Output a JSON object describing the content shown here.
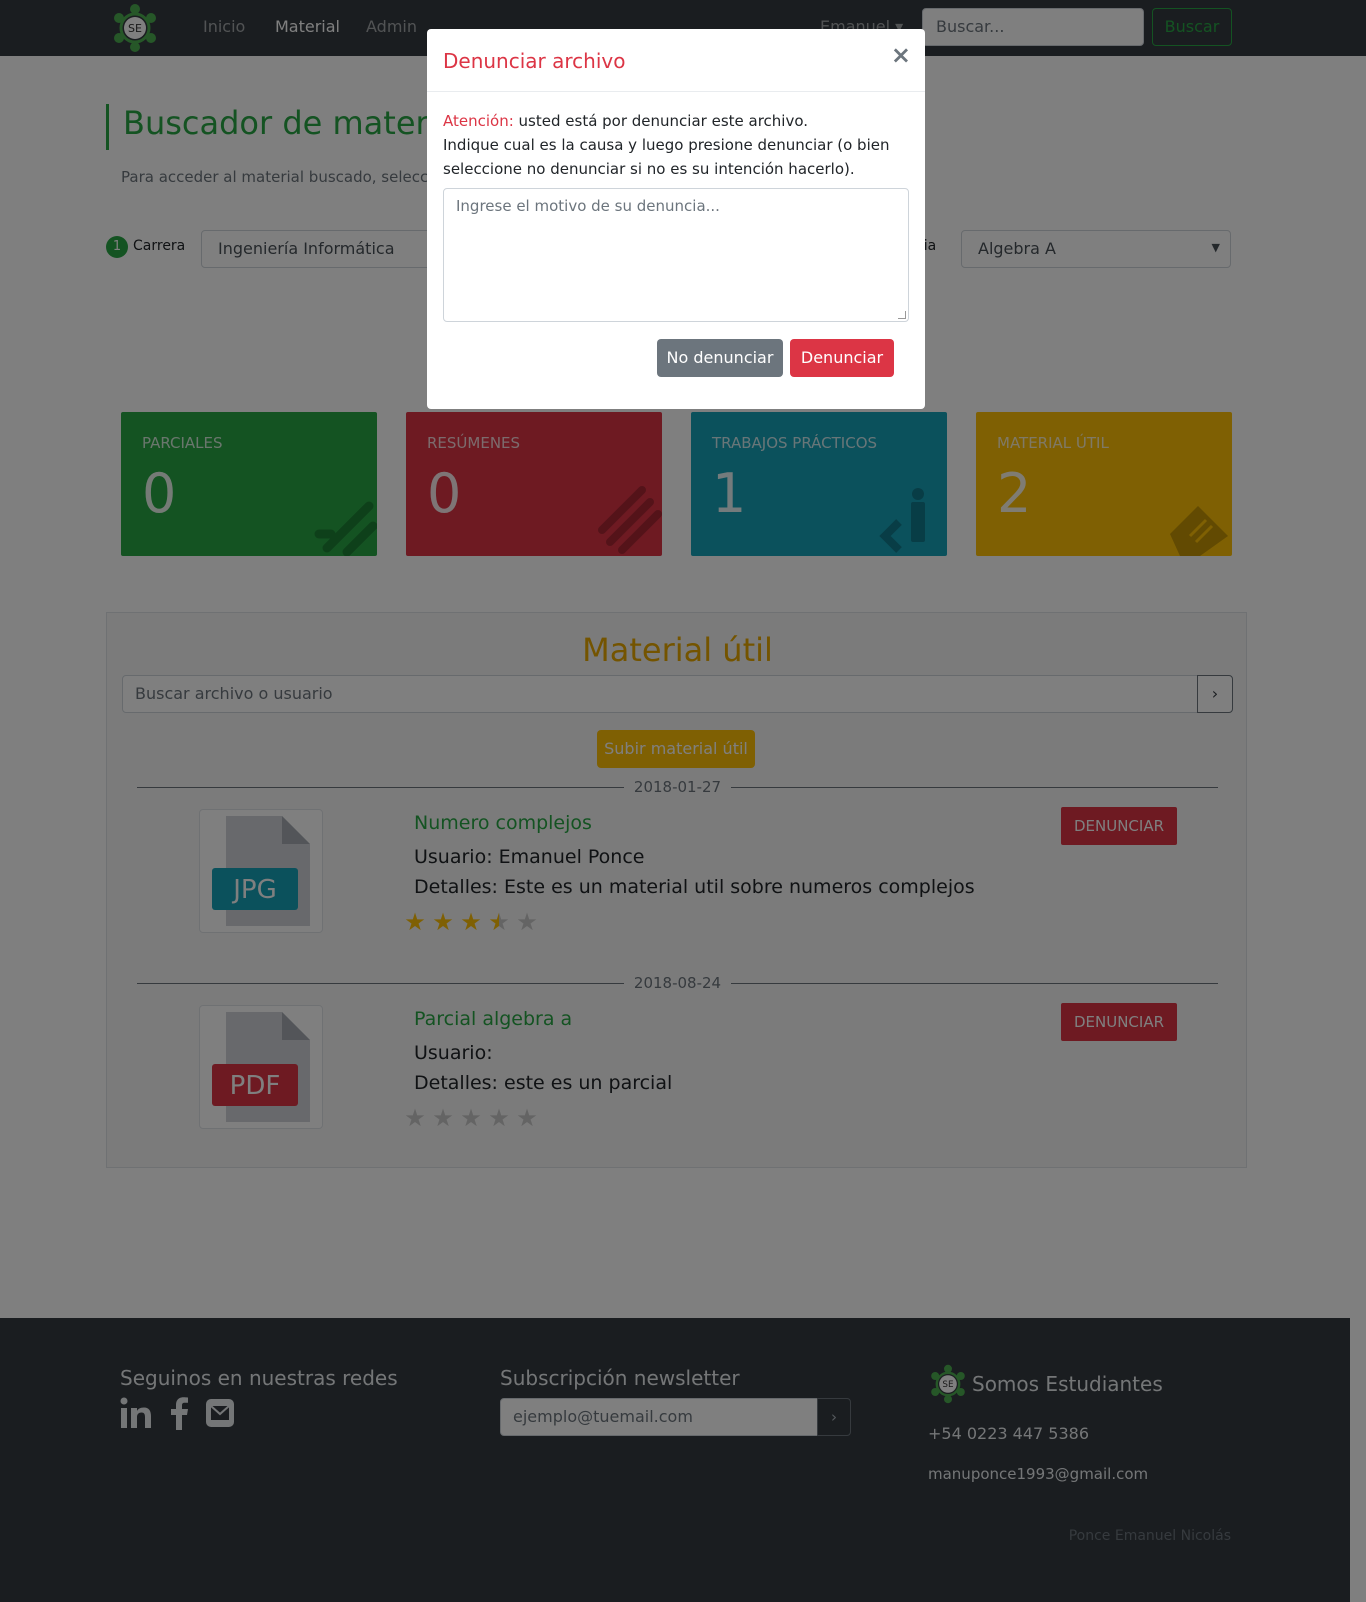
{
  "colors": {
    "brand_green": "#28a745",
    "navbar_bg": "#343a40",
    "danger": "#dc3545",
    "warning": "#ffc107",
    "info": "#17a2b8",
    "material_title": "#e8a800"
  },
  "navbar": {
    "logo_text": "SE",
    "links": [
      {
        "label": "Inicio"
      },
      {
        "label": "Material",
        "active": true
      },
      {
        "label": "Admin"
      }
    ],
    "user_menu": "Emanuel ▾",
    "search_placeholder": "Buscar...",
    "search_button": "Buscar"
  },
  "header": {
    "title": "Buscador de materia",
    "subtitle": "Para acceder al material buscado, selecci"
  },
  "filters": {
    "step_number": "1",
    "career_label": "Carrera",
    "career_value": "Ingeniería Informática",
    "subject_label_fragment": "ria",
    "subject_value": "Algebra A"
  },
  "cards": [
    {
      "title": "PARCIALES",
      "count": "0",
      "color": "#28a745",
      "icon": "edit-icon"
    },
    {
      "title": "RESÚMENES",
      "count": "0",
      "color": "#dc3545",
      "icon": "list-icon"
    },
    {
      "title": "TRABAJOS PRÁCTICOS",
      "count": "1",
      "color": "#17a2b8",
      "icon": "code-icon"
    },
    {
      "title": "MATERIAL ÚTIL",
      "count": "2",
      "color": "#ffc107",
      "icon": "book-icon"
    }
  ],
  "material": {
    "title": "Material útil",
    "search_placeholder": "Buscar archivo o usuario",
    "search_button": "›",
    "upload_button": "Subir material útil",
    "items": [
      {
        "date": "2018-01-27",
        "file_type": "JPG",
        "file_color": "#17a2b8",
        "name": "Numero complejos",
        "user": "Usuario: Emanuel Ponce",
        "details": "Detalles: Este es un material util sobre numeros complejos",
        "rating": 3.5,
        "report_label": "DENUNCIAR"
      },
      {
        "date": "2018-08-24",
        "file_type": "PDF",
        "file_color": "#dc3545",
        "name": "Parcial algebra a",
        "user": "Usuario:",
        "details": "Detalles: este es un parcial",
        "rating": 0,
        "report_label": "DENUNCIAR"
      }
    ]
  },
  "footer": {
    "social_heading": "Seguinos en nuestras redes",
    "social_icons": [
      "linkedin-icon",
      "facebook-icon",
      "envelope-icon"
    ],
    "newsletter_heading": "Subscripción newsletter",
    "newsletter_placeholder": "ejemplo@tuemail.com",
    "newsletter_button": "›",
    "brand": "Somos Estudiantes",
    "logo_text": "SE",
    "phone": "+54 0223 447 5386",
    "email": "manuponce1993@gmail.com",
    "author": "Ponce Emanuel Nicolás"
  },
  "modal": {
    "title": "Denunciar archivo",
    "close": "×",
    "warning_label": "Atención:",
    "warning_text": " usted está por denunciar este archivo.",
    "instructions": "Indique cual es la causa y luego presione denunciar (o bien seleccione no denunciar si no es su intención hacerlo).",
    "textarea_placeholder": "Ingrese el motivo de su denuncia...",
    "cancel_button": "No denunciar",
    "confirm_button": "Denunciar"
  }
}
